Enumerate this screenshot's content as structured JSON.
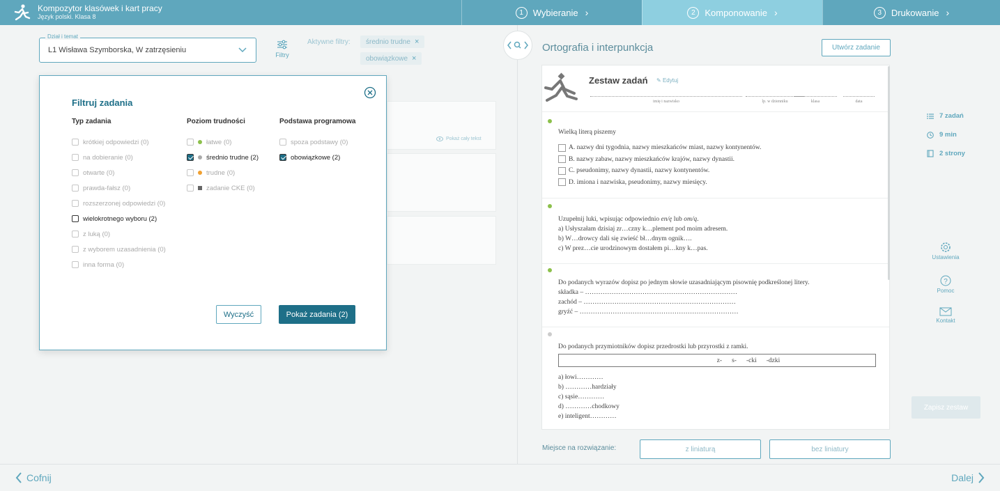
{
  "app": {
    "title": "Kompozytor klasówek i kart pracy",
    "subtitle": "Język polski. Klasa 8"
  },
  "steps": [
    {
      "num": "1",
      "label": "Wybieranie"
    },
    {
      "num": "2",
      "label": "Komponowanie"
    },
    {
      "num": "3",
      "label": "Drukowanie"
    }
  ],
  "left": {
    "dzial_legend": "Dział i temat",
    "dzial_value": "L1 Wisława Szymborska, W zatrzęsieniu",
    "filters_label": "Filtry",
    "active_filters_label": "Aktywne filtry:",
    "chips": [
      "średnio trudne",
      "obowiązkowe"
    ],
    "show_full_text": "Pokaż cały tekst"
  },
  "modal": {
    "title": "Filtruj zadania",
    "typ": {
      "heading": "Typ zadania",
      "options": [
        {
          "label": "krótkiej odpowiedzi (0)",
          "checked": false,
          "enabled": false
        },
        {
          "label": "na dobieranie (0)",
          "checked": false,
          "enabled": false
        },
        {
          "label": "otwarte (0)",
          "checked": false,
          "enabled": false
        },
        {
          "label": "prawda-fałsz (0)",
          "checked": false,
          "enabled": false
        },
        {
          "label": "rozszerzonej odpowiedzi (0)",
          "checked": false,
          "enabled": false
        },
        {
          "label": "wielokrotnego wyboru (2)",
          "checked": false,
          "enabled": true
        },
        {
          "label": "z luką (0)",
          "checked": false,
          "enabled": false
        },
        {
          "label": "z wyborem uzasadnienia (0)",
          "checked": false,
          "enabled": false
        },
        {
          "label": "inna forma (0)",
          "checked": false,
          "enabled": false
        }
      ]
    },
    "poziom": {
      "heading": "Poziom trudności",
      "options": [
        {
          "label": "łatwe (0)",
          "checked": false,
          "enabled": false,
          "marker": "dot",
          "color": "#8cc04b"
        },
        {
          "label": "średnio trudne (2)",
          "checked": true,
          "enabled": true,
          "marker": "dot",
          "color": "#aaaaaa"
        },
        {
          "label": "trudne (0)",
          "checked": false,
          "enabled": false,
          "marker": "dot",
          "color": "#f0a030"
        },
        {
          "label": "zadanie CKE (0)",
          "checked": false,
          "enabled": false,
          "marker": "square",
          "color": "#666666"
        }
      ]
    },
    "podstawa": {
      "heading": "Podstawa programowa",
      "options": [
        {
          "label": "spoza podstawy (0)",
          "checked": false,
          "enabled": false
        },
        {
          "label": "obowiązkowe (2)",
          "checked": true,
          "enabled": true
        }
      ]
    },
    "clear_label": "Wyczyść",
    "show_label": "Pokaż zadania (2)"
  },
  "right": {
    "section_title": "Ortografia i interpunkcja",
    "create_label": "Utwórz zadanie",
    "sheet": {
      "title": "Zestaw zadań",
      "edit": "Edytuj",
      "fields": [
        "imię i nazwisko",
        "lp. w dzienniku",
        "klasa",
        "data"
      ],
      "task1": {
        "question": "Wielką literą piszemy",
        "answers": [
          "A. nazwy dni tygodnia, nazwy mieszkańców miast, nazwy kontynentów.",
          "B. nazwy zabaw, nazwy mieszkańców krajów, nazwy dynastii.",
          "C. pseudonimy, nazwy dynastii, nazwy kontynentów.",
          "D. imiona i nazwiska, pseudonimy, nazwy miesięcy."
        ]
      },
      "task2": {
        "q_start": "Uzupełnij luki, wpisując odpowiednio ",
        "q_em": "en/ę",
        "q_mid": " lub ",
        "q_em2": "om/ą",
        "q_end": ".",
        "lines": [
          "a) Usłyszałam dzisiaj zr…czny k…plement pod moim adresem.",
          "b) W…drowcy dali się zwieść bł…dnym ognik….",
          "c) W prez…cie urodzinowym dostałem pi…kny k…pas."
        ]
      },
      "task3": {
        "question": "Do podanych wyrazów dopisz po jednym słowie uzasadniającym pisownię podkreślonej litery.",
        "lines": [
          "składka – ……………………………………………………………",
          "zachód – ……………………………………………………………",
          "gryźć – ………………………………………………………………"
        ]
      },
      "task4": {
        "question": "Do podanych przymiotników dopisz przedrostki lub przyrostki z ramki.",
        "frame": [
          "z-",
          "s-",
          "-cki",
          "-dzki"
        ],
        "lines": [
          "a) łowi…………",
          "b) …………hardziały",
          "c) sąsie…………",
          "d) …………chodkowy",
          "e) inteligent…………"
        ]
      }
    },
    "stats": [
      "7 zadań",
      "9 min",
      "2 strony"
    ],
    "links": [
      "Ustawienia",
      "Pomoc",
      "Kontakt"
    ],
    "save_label": "Zapisz zestaw",
    "miejsce_label": "Miejsce na rozwiązanie:",
    "miejsce_opts": [
      "z liniaturą",
      "bez liniatury"
    ]
  },
  "bottom": {
    "back": "Cofnij",
    "next": "Dalej"
  },
  "colors": {
    "accent": "#5fa7bd",
    "dark_accent": "#1e6f88",
    "active_step": "#8ecfe0",
    "easy": "#8cc04b"
  }
}
